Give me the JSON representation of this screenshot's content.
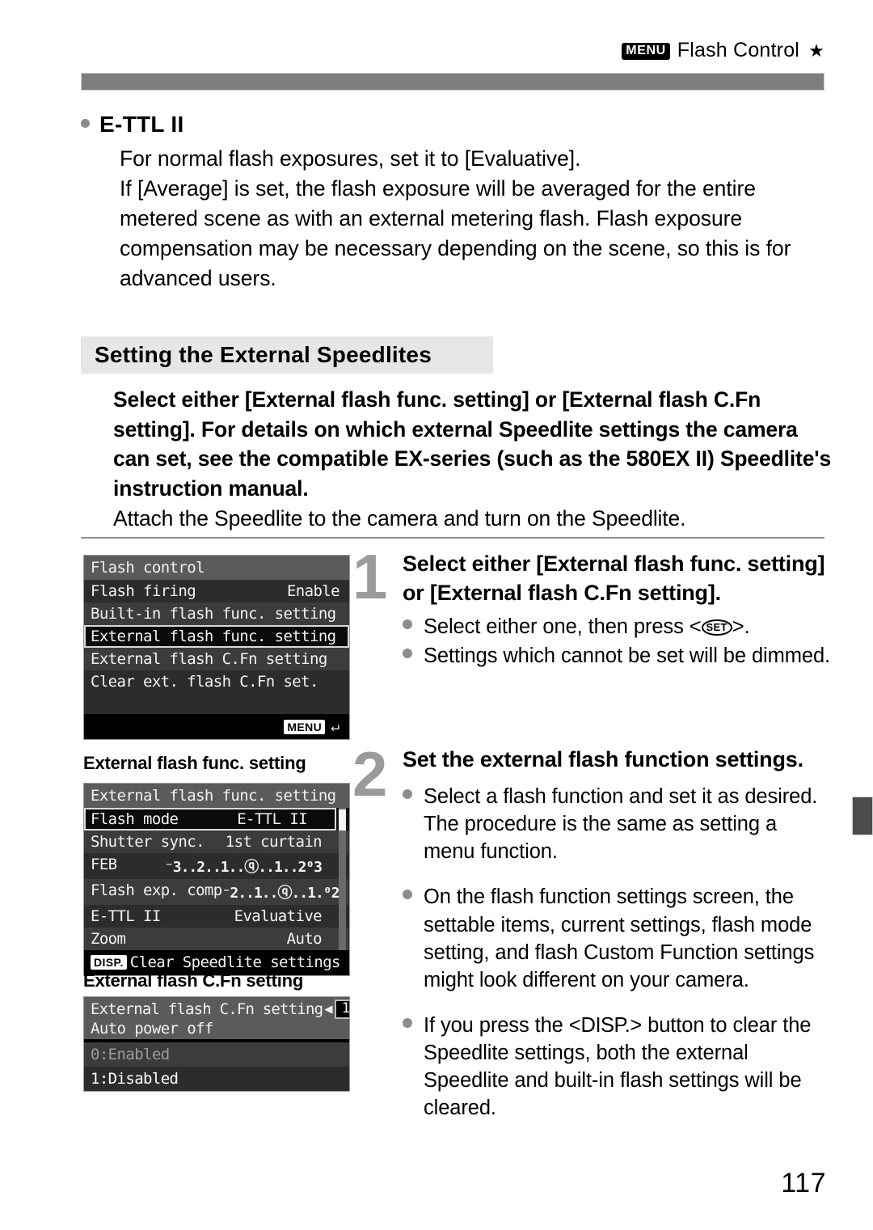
{
  "header": {
    "menu_chip": "MENU",
    "title": "Flash Control",
    "star": "★"
  },
  "intro": {
    "heading": "E-TTL II",
    "line1": "For normal flash exposures, set it to [Evaluative].",
    "line2": "If [Average] is set, the flash exposure will be averaged for the entire metered scene as with an external metering flash. Flash exposure compensation may be necessary depending on the scene, so this is for advanced users."
  },
  "section": {
    "title": "Setting the External Speedlites",
    "lead": "Select either [External flash func. setting] or [External flash C.Fn setting]. For details on which external Speedlite settings the camera can set, see the compatible EX-series (such as the 580EX II) Speedlite's instruction manual.",
    "lead2": "Attach the Speedlite to the camera and turn on the Speedlite."
  },
  "lcd_flash_control": {
    "title": "Flash control",
    "rows": [
      {
        "label": "Flash firing",
        "value": "Enable"
      },
      {
        "label": "Built-in flash func. setting",
        "value": ""
      },
      {
        "label": "External flash func. setting",
        "value": ""
      },
      {
        "label": "External flash C.Fn setting",
        "value": ""
      },
      {
        "label": "Clear ext. flash C.Fn set.",
        "value": ""
      }
    ],
    "selected_index": 2,
    "footer_chip": "MENU",
    "footer_icon": "return-arrow-icon"
  },
  "caption_func": "External flash func. setting",
  "lcd_func_setting": {
    "title": "External flash func. setting",
    "rows": [
      {
        "label": "Flash mode",
        "value": "E-TTL II"
      },
      {
        "label": "Shutter sync.",
        "value": "1st curtain"
      },
      {
        "label": "FEB",
        "value": "⁻3..2..1..ⓠ..1..2⁰3"
      },
      {
        "label": "Flash exp. comp",
        "value": "⁻2..1..ⓠ..1.⁰2"
      },
      {
        "label": "E-TTL II",
        "value": "Evaluative"
      },
      {
        "label": "Zoom",
        "value": "Auto"
      }
    ],
    "selected_index": 0,
    "footer_chip": "DISP.",
    "footer_label": "Clear Speedlite settings"
  },
  "caption_cfn": "External flash C.Fn setting",
  "lcd_cfn_setting": {
    "title": "External flash C.Fn setting",
    "number": "1",
    "left_arrow": "◀",
    "right_arrow": "▶",
    "subtitle": "Auto power off",
    "options": [
      {
        "label": "0:Enabled",
        "state": "dimmed"
      },
      {
        "label": "1:Disabled",
        "state": "active"
      }
    ]
  },
  "steps": [
    {
      "number": "1",
      "title": "Select either [External flash func. setting] or [External flash C.Fn setting].",
      "bullets": [
        {
          "pre": "Select either one, then press <",
          "icon": "SET",
          "post": ">."
        },
        {
          "pre": "Settings which cannot be set will be dimmed.",
          "icon": "",
          "post": ""
        }
      ]
    },
    {
      "number": "2",
      "title": "Set the external flash function settings.",
      "bullets": [
        {
          "pre": "Select a flash function and set it as desired. The procedure is the same as setting a menu function.",
          "icon": "",
          "post": ""
        },
        {
          "pre": "On the flash function settings screen, the settable items, current settings, flash mode setting, and flash Custom Function settings might look different on your camera.",
          "icon": "",
          "post": ""
        },
        {
          "pre": "If you press the <",
          "icon": "DISP.",
          "post": "> button to clear the Speedlite settings, both the external Speedlite and built-in flash settings will be cleared."
        }
      ]
    }
  ],
  "page_number": "117",
  "colors": {
    "header_bar": "#7e7e7e",
    "section_title_bg": "#e6e6e6",
    "step_number": "#9b9b9b",
    "bullet_dot": "#8d8d8d",
    "lcd_bg": "#121212",
    "side_tab": "#4c4c4c"
  }
}
